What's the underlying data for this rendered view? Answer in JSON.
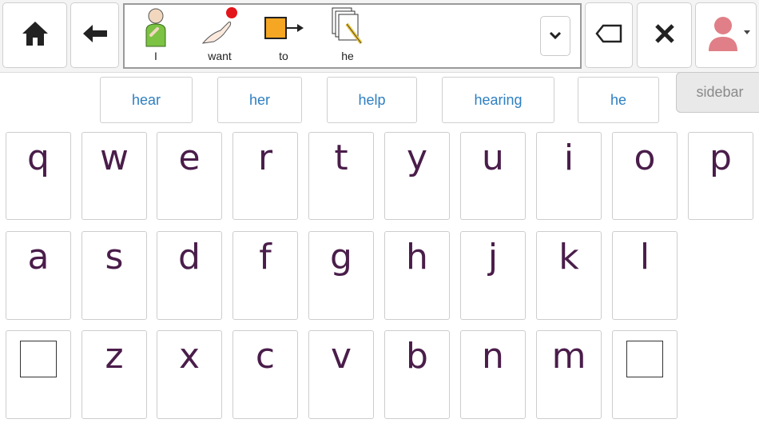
{
  "toolbar": {
    "home_icon": "home-icon",
    "back_icon": "back-arrow-icon",
    "backspace_icon": "backspace-icon",
    "clear_icon": "clear-x-icon",
    "user_icon": "user-avatar-icon"
  },
  "message": {
    "symbols": [
      {
        "label": "I",
        "icon": "person-pointing-self-icon"
      },
      {
        "label": "want",
        "icon": "hand-reaching-ball-icon"
      },
      {
        "label": "to",
        "icon": "box-arrow-icon"
      },
      {
        "label": "he",
        "icon": "papers-pencil-icon"
      }
    ]
  },
  "predictions": [
    "hear",
    "her",
    "help",
    "hearing",
    "he"
  ],
  "sidebar": {
    "label": "sidebar"
  },
  "keyboard": {
    "row1": [
      "q",
      "w",
      "e",
      "r",
      "t",
      "y",
      "u",
      "i",
      "o",
      "p"
    ],
    "row2": [
      "a",
      "s",
      "d",
      "f",
      "g",
      "h",
      "j",
      "k",
      "l"
    ],
    "row3": [
      "z",
      "x",
      "c",
      "v",
      "b",
      "n",
      "m"
    ]
  },
  "colors": {
    "letter": "#4a1d4a",
    "prediction": "#2e7fc1",
    "user_avatar": "#e07f87"
  }
}
